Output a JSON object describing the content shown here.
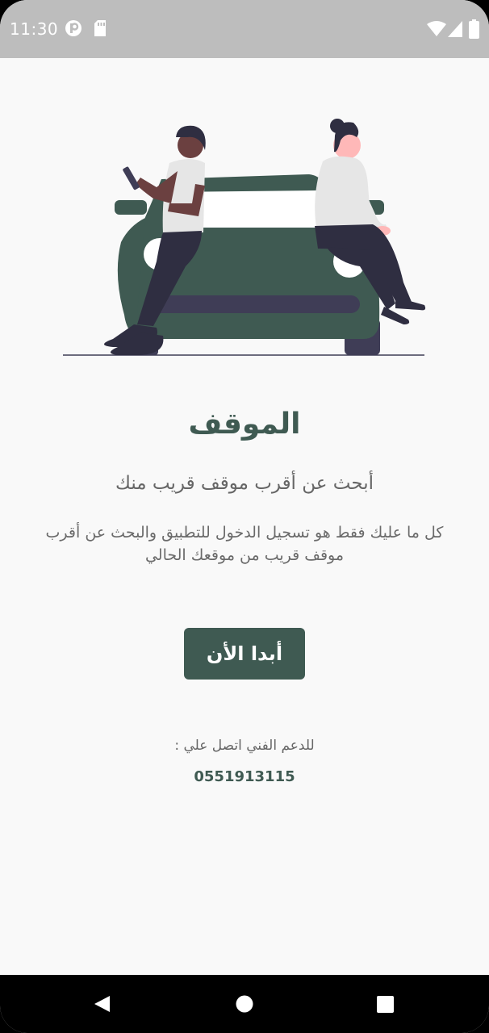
{
  "status_bar": {
    "time": "11:30",
    "left_icons": [
      "p-app-icon",
      "sd-card-icon"
    ],
    "right_icons": [
      "wifi-icon",
      "cell-signal-icon",
      "battery-icon"
    ]
  },
  "illustration": {
    "name": "people-leaning-on-car",
    "colors": {
      "car": "#3f5a52",
      "wheels": "#3f3d56",
      "shirts": "#e6e6e6",
      "pants": "#2f2e41",
      "skin_dark": "#6b4040",
      "skin_light": "#ffb8b8"
    }
  },
  "main": {
    "title": "الموقف",
    "subtitle": "أبحث عن أقرب موقف قريب منك",
    "description": "كل ما عليك فقط هو تسجيل الدخول للتطبيق والبحث عن أقرب موقف قريب من موقعك الحالي",
    "start_button_label": "أبدا الأن",
    "support_label": "للدعم الفني اتصل علي :",
    "support_phone": "0551913115"
  },
  "nav_bar": {
    "buttons": [
      "back-icon",
      "home-icon",
      "recents-icon"
    ]
  },
  "colors": {
    "accent": "#3f5a52",
    "background": "#f9f9f9",
    "status_bar": "#bdbdbd",
    "text_gray": "#666666"
  }
}
